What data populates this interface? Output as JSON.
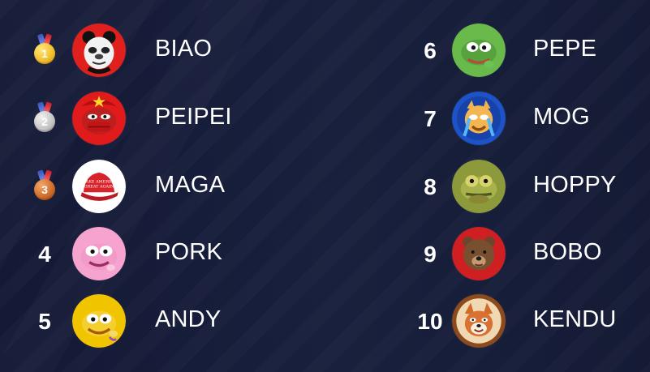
{
  "leaderboard": {
    "entries": [
      {
        "rank": "1",
        "name": "BIAO",
        "avatar_icon": "panda-face-icon",
        "medal": "gold"
      },
      {
        "rank": "2",
        "name": "PEIPEI",
        "avatar_icon": "red-masked-frog-icon",
        "medal": "silver"
      },
      {
        "rank": "3",
        "name": "MAGA",
        "avatar_icon": "red-cap-icon",
        "medal": "bronze"
      },
      {
        "rank": "4",
        "name": "PORK",
        "avatar_icon": "pink-frog-icon"
      },
      {
        "rank": "5",
        "name": "ANDY",
        "avatar_icon": "yellow-frog-icon"
      },
      {
        "rank": "6",
        "name": "PEPE",
        "avatar_icon": "green-frog-icon"
      },
      {
        "rank": "7",
        "name": "MOG",
        "avatar_icon": "crying-cat-icon"
      },
      {
        "rank": "8",
        "name": "HOPPY",
        "avatar_icon": "green-toad-icon"
      },
      {
        "rank": "9",
        "name": "BOBO",
        "avatar_icon": "bear-icon"
      },
      {
        "rank": "10",
        "name": "KENDU",
        "avatar_icon": "shiba-dog-icon"
      }
    ],
    "cap_text": {
      "line1": "MAKE AMERICA",
      "line2": "GREAT AGAIN"
    },
    "colors": {
      "background": "#151a35",
      "text": "#ffffff",
      "gold": "#f2c030",
      "silver": "#c4c4c4",
      "bronze": "#cf6b29"
    }
  }
}
